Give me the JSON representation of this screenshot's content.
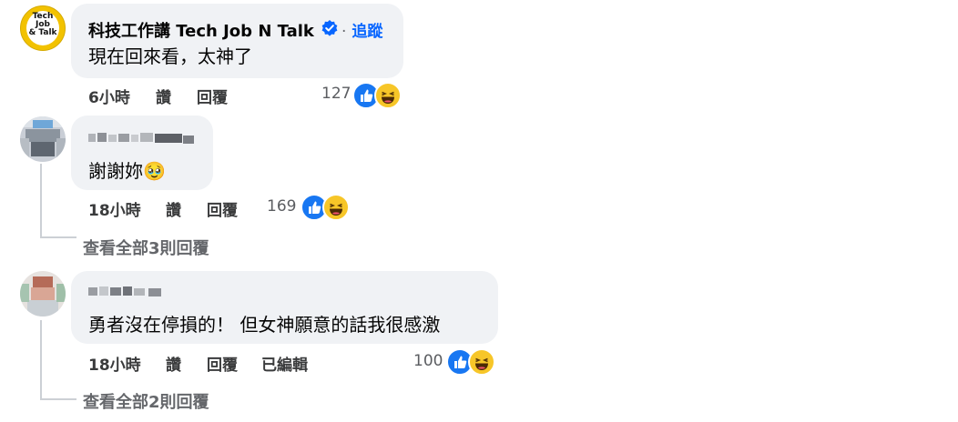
{
  "comments": [
    {
      "author": "科技工作講 Tech Job N Talk",
      "follow_sep": "·",
      "follow_label": "追蹤",
      "text": "現在回來看，太神了",
      "time": "6小時",
      "like_label": "讚",
      "reply_label": "回覆",
      "reaction_count": "127",
      "avatar_text": [
        "Tech",
        "Job",
        "& Talk"
      ]
    },
    {
      "author": "",
      "text": "謝謝妳🥹",
      "time": "18小時",
      "like_label": "讚",
      "reply_label": "回覆",
      "reaction_count": "169",
      "view_replies": "查看全部3則回覆"
    },
    {
      "author": "",
      "text": "勇者沒在停損的！ 但女神願意的話我很感激",
      "time": "18小時",
      "like_label": "讚",
      "reply_label": "回覆",
      "edited_label": "已編輯",
      "reaction_count": "100",
      "view_replies": "查看全部2則回覆"
    }
  ],
  "colors": {
    "bubble": "#f0f2f5",
    "link_blue": "#0866ff",
    "like_blue": "#1877f2",
    "haha_yellow": "#f7c628",
    "meta_gray": "#65676b"
  },
  "icons": [
    "verified-badge-icon",
    "like-reaction-icon",
    "haha-reaction-icon"
  ]
}
